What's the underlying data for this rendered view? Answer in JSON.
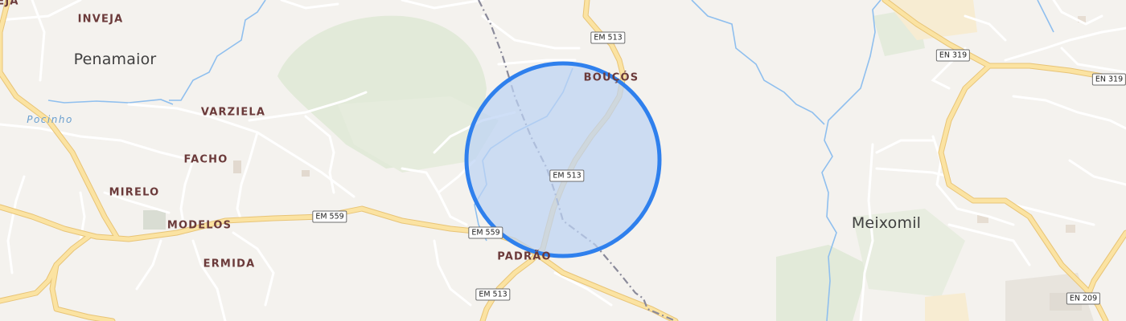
{
  "map": {
    "places": {
      "penamaior": "Penamaior",
      "meixomil": "Meixomil",
      "inveja": "INVEJA",
      "eja_partial": "EJA",
      "varziela": "VARZIELA",
      "facho": "FACHO",
      "mirelo": "MIRELO",
      "modelos": "MODELOS",
      "ermida": "ERMIDA",
      "boucos": "BOUÇÓS",
      "padrao": "PADRÃO"
    },
    "water": {
      "pocinho": "Pocinho"
    },
    "roads": {
      "em513_top": "EM 513",
      "em513_center": "EM 513",
      "em513_bottom": "EM 513",
      "em559_left": "EM 559",
      "em559_right": "EM 559",
      "en319_left": "EN 319",
      "en319_right": "EN 319",
      "en209": "EN 209"
    },
    "colors": {
      "background": "#f4f2ee",
      "forest": "#e2ead9",
      "major_road": "#fbe3a2",
      "major_road_casing": "#e8c476",
      "minor_road": "#ffffff",
      "water": "#8fbfee",
      "railway": "#8a8a9a",
      "radius_fill": "#bcd2f4",
      "radius_stroke": "#2f80ed"
    }
  }
}
